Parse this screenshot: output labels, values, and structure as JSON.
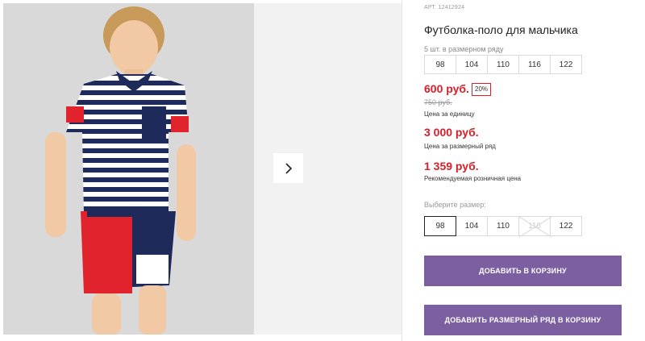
{
  "product": {
    "article": "АРТ. 12412924",
    "title": "Футболка-поло для мальчика",
    "pack_caption": "5 шт. в размерном ряду",
    "pack_sizes": [
      "98",
      "104",
      "110",
      "116",
      "122"
    ],
    "price": "600 руб.",
    "discount": "20%",
    "old_price": "750 руб.",
    "price_caption": "Цена за единицу",
    "pack_price": "3 000 руб.",
    "pack_price_caption": "Цена за размерный ряд",
    "retail_price": "1 359 руб.",
    "retail_caption": "Рекомендуемая розничная цена",
    "choose_size_label": "Выберите размер:",
    "sizes": [
      {
        "label": "98",
        "state": "selected"
      },
      {
        "label": "104",
        "state": "available"
      },
      {
        "label": "110",
        "state": "available"
      },
      {
        "label": "116",
        "state": "disabled"
      },
      {
        "label": "122",
        "state": "available"
      }
    ],
    "add_to_cart": "ДОБАВИТЬ В КОРЗИНУ",
    "add_pack_to_cart": "ДОБАВИТЬ РАЗМЕРНЫЙ РЯД В КОРЗИНУ"
  },
  "colors": {
    "accent_red": "#d6202a",
    "button_purple": "#7b5fa0"
  },
  "icons": {
    "next": "chevron-right-icon"
  }
}
